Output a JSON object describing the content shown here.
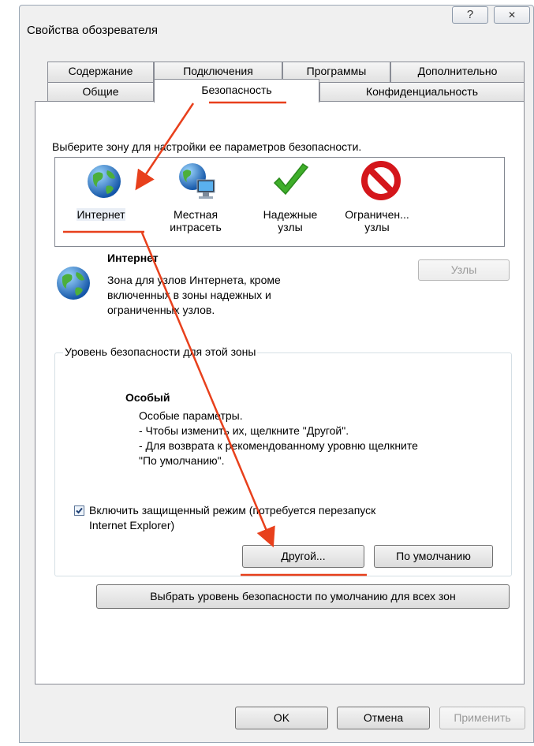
{
  "window": {
    "title": "Свойства обозревателя",
    "help_glyph": "?",
    "close_glyph": "✕"
  },
  "tabs": {
    "row1": [
      "Содержание",
      "Подключения",
      "Программы",
      "Дополнительно"
    ],
    "row2": [
      "Общие",
      "Безопасность",
      "Конфиденциальность"
    ],
    "active": "Безопасность"
  },
  "security": {
    "prompt": "Выберите зону для настройки ее параметров безопасности.",
    "zones": [
      {
        "line1": "Интернет",
        "line2": "",
        "icon": "globe-icon"
      },
      {
        "line1": "Местная",
        "line2": "интрасеть",
        "icon": "intranet-globe-icon"
      },
      {
        "line1": "Надежные",
        "line2": "узлы",
        "icon": "checkmark-icon"
      },
      {
        "line1": "Ограничен...",
        "line2": "узлы",
        "icon": "no-entry-icon"
      }
    ],
    "selected_zone": "Интернет",
    "zone_title": "Интернет",
    "zone_desc": [
      "Зона для узлов Интернета, кроме",
      "включенных в зоны надежных и",
      "ограниченных узлов."
    ],
    "sites_button": "Узлы",
    "level_group_title": "Уровень безопасности для этой зоны",
    "level_name": "Особый",
    "level_desc": [
      "Особые параметры.",
      "- Чтобы изменить их, щелкните \"Другой\".",
      "- Для возврата к рекомендованному уровню щелкните",
      "\"По умолчанию\"."
    ],
    "protected_mode": {
      "checked": true,
      "line1": "Включить защищенный режим (потребуется перезапуск",
      "line2": "Internet Explorer)"
    },
    "custom_button": "Другой...",
    "default_button": "По умолчанию",
    "reset_all_button": "Выбрать уровень безопасности по умолчанию для всех зон"
  },
  "footer": {
    "ok": "OK",
    "cancel": "Отмена",
    "apply": "Применить"
  },
  "colors": {
    "annotation": "#e8401c",
    "window_bg": "#f0f0f0",
    "border": "#898c95"
  }
}
